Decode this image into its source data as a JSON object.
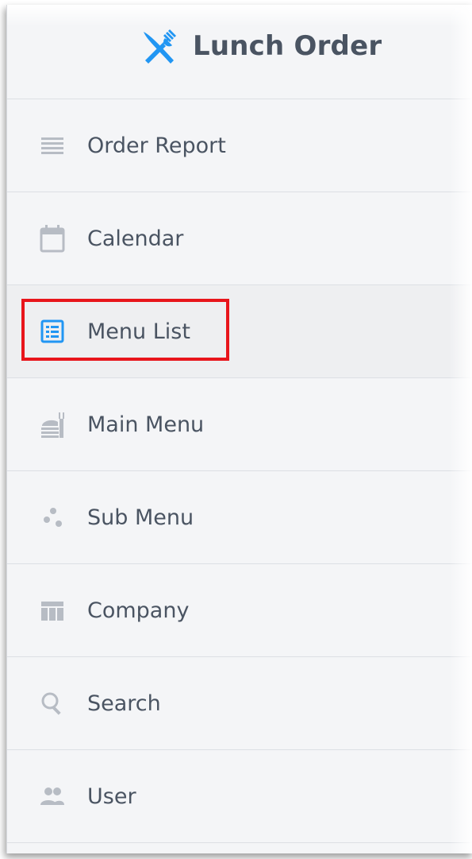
{
  "app": {
    "title": "Lunch Order",
    "logo_icon": "fork-knife-cross-icon",
    "accent_color": "#2196f3"
  },
  "sidebar": {
    "items": [
      {
        "label": "Order Report",
        "icon": "list-lines-icon",
        "active": false
      },
      {
        "label": "Calendar",
        "icon": "calendar-icon",
        "active": false
      },
      {
        "label": "Menu List",
        "icon": "menu-list-icon",
        "active": true
      },
      {
        "label": "Main Menu",
        "icon": "dish-stack-icon",
        "active": false
      },
      {
        "label": "Sub Menu",
        "icon": "dots-cluster-icon",
        "active": false
      },
      {
        "label": "Company",
        "icon": "building-table-icon",
        "active": false
      },
      {
        "label": "Search",
        "icon": "search-icon",
        "active": false
      },
      {
        "label": "User",
        "icon": "users-icon",
        "active": false
      }
    ]
  },
  "annotation": {
    "highlight_color": "#e8151b",
    "highlighted_item": "Menu List"
  }
}
